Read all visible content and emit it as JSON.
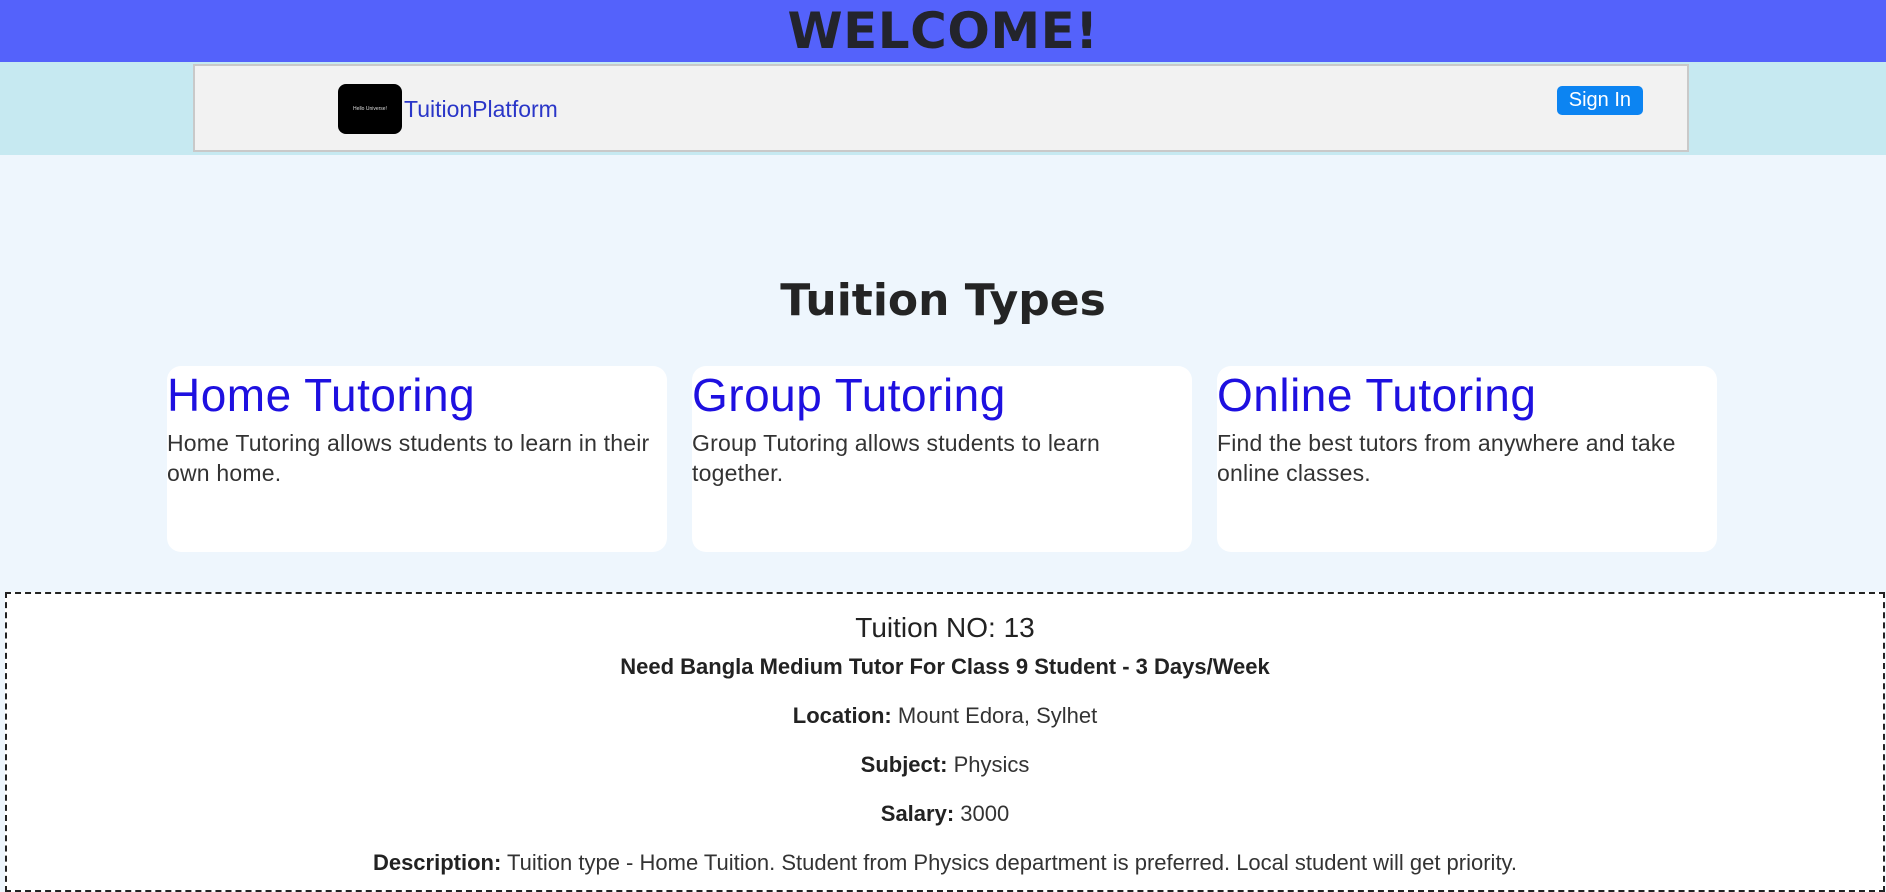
{
  "header": {
    "welcome": "WELCOME!"
  },
  "nav": {
    "logo_text": "Hello Universe!",
    "brand": "TuitionPlatform",
    "signin_label": "Sign In"
  },
  "types": {
    "title": "Tuition Types",
    "cards": [
      {
        "title": "Home Tutoring",
        "desc": "Home Tutoring allows students to learn in their own home."
      },
      {
        "title": "Group Tutoring",
        "desc": "Group Tutoring allows students to learn together."
      },
      {
        "title": "Online Tutoring",
        "desc": "Find the best tutors from anywhere and take online classes."
      }
    ]
  },
  "tuition": {
    "number_label": "Tuition NO: 13",
    "title": "Need Bangla Medium Tutor For Class 9 Student - 3 Days/Week",
    "location_label": "Location:",
    "location": "Mount Edora, Sylhet",
    "subject_label": "Subject:",
    "subject": "Physics",
    "salary_label": "Salary:",
    "salary": "3000",
    "description_label": "Description:",
    "description": "Tuition type - Home Tuition. Student from Physics department is preferred. Local student will get priority."
  },
  "colors": {
    "welcome_bg": "#5462fb",
    "nav_band": "#c6e9f1",
    "link": "#1e10e0",
    "signin_bg": "#0c84f2"
  }
}
